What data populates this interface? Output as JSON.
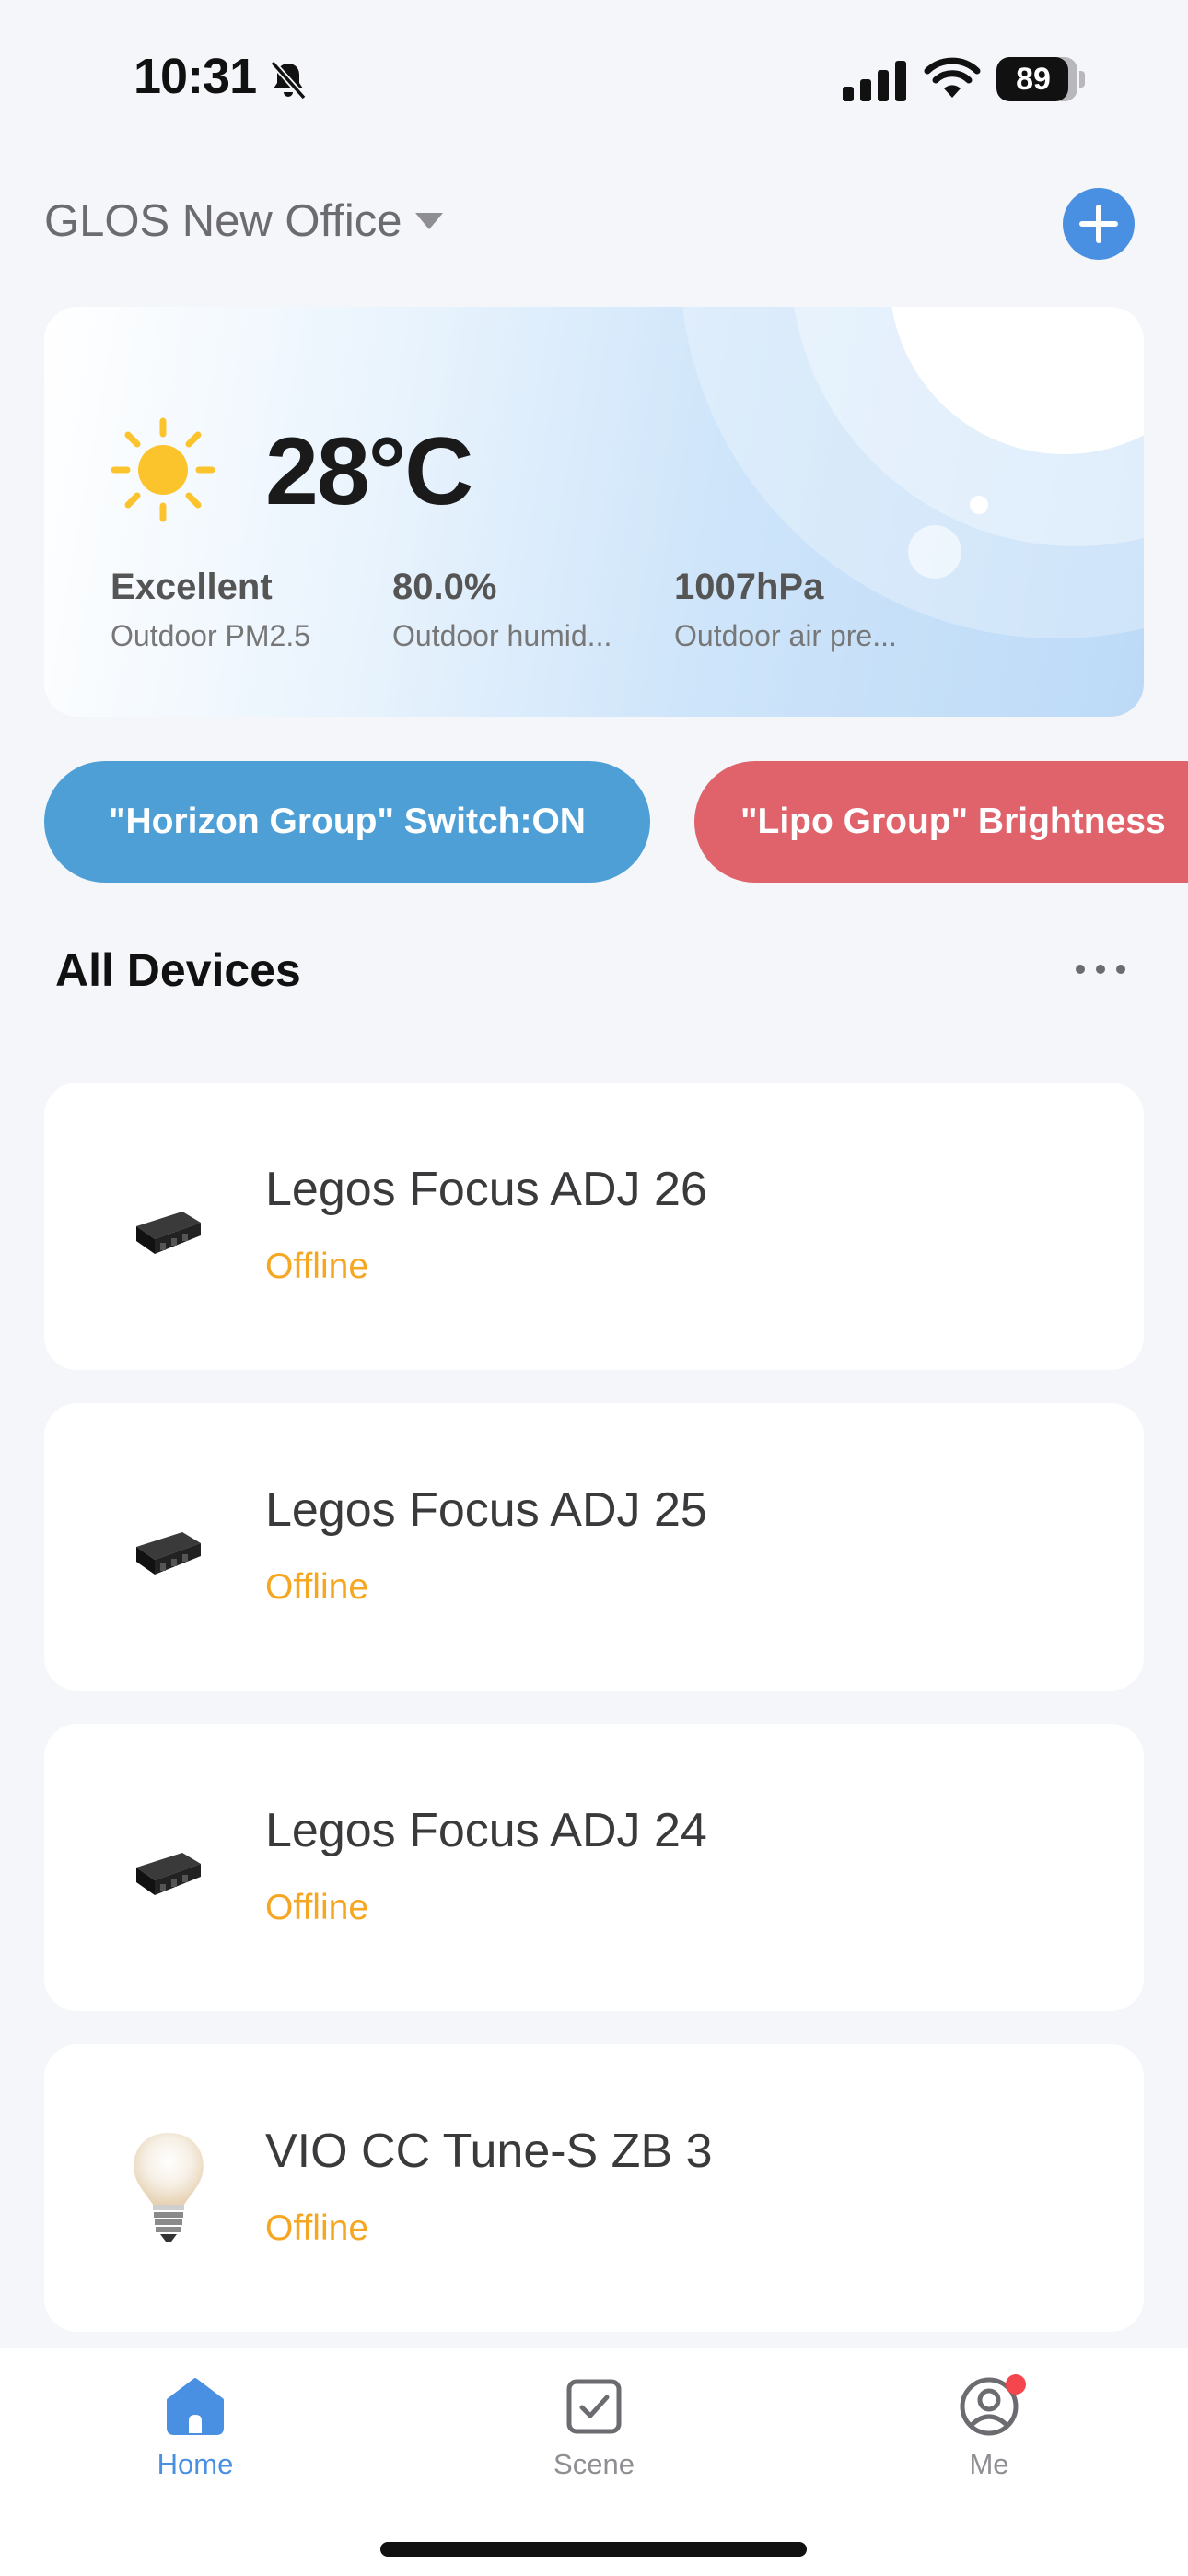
{
  "status_bar": {
    "time": "10:31",
    "battery": "89",
    "battery_level": 0.89
  },
  "header": {
    "home_name": "GLOS New Office"
  },
  "weather": {
    "temperature": "28°C",
    "icon": "sun-icon",
    "metrics": [
      {
        "value": "Excellent",
        "label": "Outdoor PM2.5"
      },
      {
        "value": "80.0%",
        "label": "Outdoor humid..."
      },
      {
        "value": "1007hPa",
        "label": "Outdoor air pre..."
      }
    ]
  },
  "scenes": [
    {
      "label": "\"Horizon Group\" Switch:ON",
      "color": "#4d9fd6"
    },
    {
      "label": "\"Lipo Group\" Brightness",
      "color": "#e0626b"
    }
  ],
  "devices_section": {
    "title": "All Devices"
  },
  "devices": [
    {
      "name": "Legos Focus ADJ 26",
      "status": "Offline",
      "icon": "spotlight-icon"
    },
    {
      "name": "Legos Focus ADJ 25",
      "status": "Offline",
      "icon": "spotlight-icon"
    },
    {
      "name": "Legos Focus ADJ 24",
      "status": "Offline",
      "icon": "spotlight-icon"
    },
    {
      "name": "VIO CC Tune-S ZB 3",
      "status": "Offline",
      "icon": "bulb-icon"
    }
  ],
  "tabs": [
    {
      "label": "Home",
      "icon": "home-icon",
      "active": true
    },
    {
      "label": "Scene",
      "icon": "scene-check-icon",
      "active": false
    },
    {
      "label": "Me",
      "icon": "profile-icon",
      "active": false
    }
  ],
  "colors": {
    "accent": "#4a90e2",
    "offline": "#f5a623",
    "badge": "#f5454d"
  }
}
